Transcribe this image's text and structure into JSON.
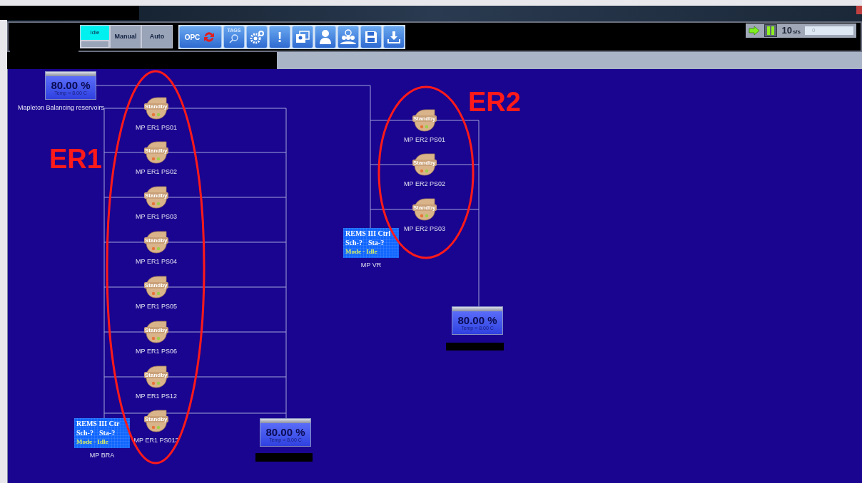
{
  "toolbar": {
    "modes": [
      {
        "label": "Idle",
        "selected": true
      },
      {
        "label": "Manual",
        "selected": false
      },
      {
        "label": "Auto",
        "selected": false
      }
    ],
    "opc_button": "OPC",
    "tags_button": "TAGS",
    "alert_button": "!",
    "rate": {
      "value": "10",
      "unit": "s/s"
    },
    "counter": "0"
  },
  "diagram": {
    "reservoirs": [
      {
        "name": "Mapleton Balancing reservoirs",
        "percent": "80.00 %",
        "temp": "Temp = 8.00 C"
      },
      {
        "percent": "80.00 %",
        "temp": "Temp = 8.00 C"
      },
      {
        "percent": "80.00 %",
        "temp": "Temp = 8.00 C"
      }
    ],
    "groups": [
      {
        "label": "ER1",
        "pumps": [
          {
            "name": "MP ER1 PS01",
            "status": "Standby"
          },
          {
            "name": "MP ER1 PS02",
            "status": "Standby"
          },
          {
            "name": "MP ER1 PS03",
            "status": "Standby"
          },
          {
            "name": "MP ER1 PS04",
            "status": "Standby"
          },
          {
            "name": "MP ER1 PS05",
            "status": "Standby"
          },
          {
            "name": "MP ER1 PS06",
            "status": "Standby"
          },
          {
            "name": "MP ER1 PS12",
            "status": "Standby"
          },
          {
            "name": "MP ER1 PS013",
            "status": "Standby"
          }
        ]
      },
      {
        "label": "ER2",
        "pumps": [
          {
            "name": "MP ER2 PS01",
            "status": "Standby"
          },
          {
            "name": "MP ER2 PS02",
            "status": "Standby"
          },
          {
            "name": "MP ER2 PS03",
            "status": "Standby"
          }
        ]
      }
    ],
    "controllers": [
      {
        "title": "REMS III Ctrl",
        "sch": "Sch-?",
        "sta": "Sta-?",
        "mode": "Mode - Idle",
        "name": "MP VR"
      },
      {
        "title": "REMS III Ctr",
        "sch": "Sch-?",
        "sta": "Sta-?",
        "mode": "Mode - Idle",
        "name": "MP BRA"
      }
    ]
  }
}
